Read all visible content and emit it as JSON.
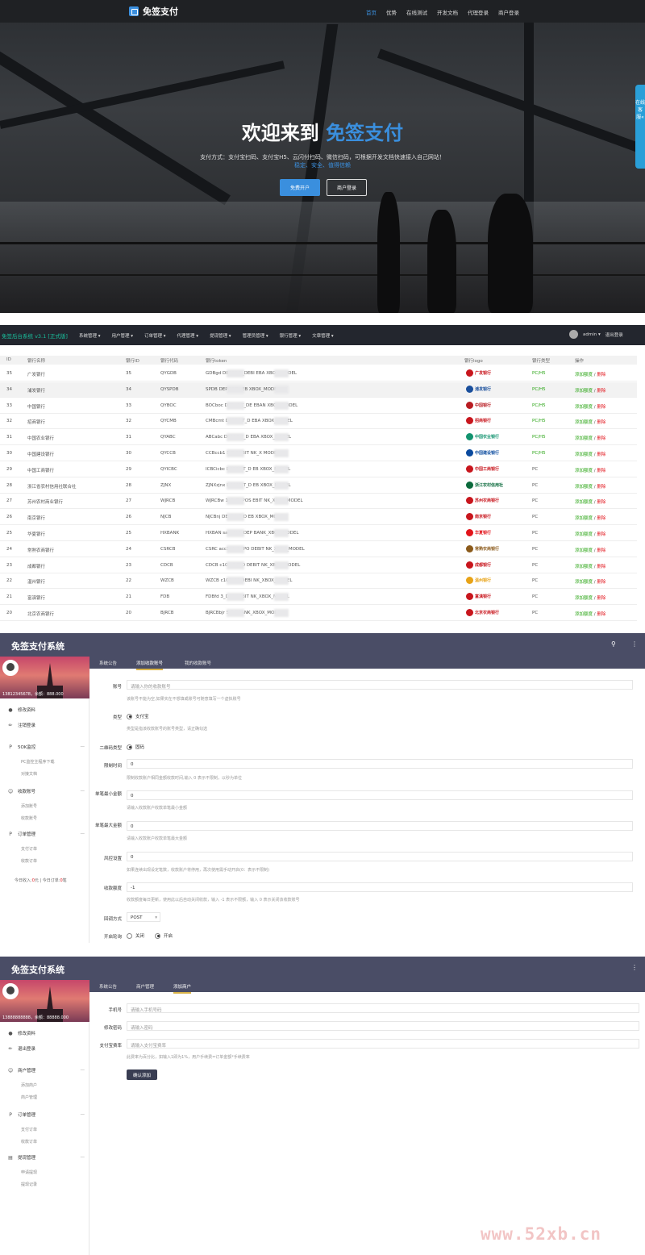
{
  "hero": {
    "brand": "免签支付",
    "nav": [
      "首页",
      "优势",
      "在线测试",
      "开发文档",
      "代理登录",
      "商户登录"
    ],
    "title_prefix": "欢迎来到",
    "title_highlight": "免签支付",
    "desc_line1": "支付方式：支付宝扫码、支付宝H5、云闪付扫码、微信扫码，可根据开发文档快速接入自己网站！",
    "desc_line2": "稳定、安全、值得信赖",
    "btn_register": "免费开户",
    "btn_login": "商户登录",
    "side_tab": "在线客服«",
    "accent": "#3a8fde"
  },
  "admin": {
    "brand": "免签后台系统 v3.1 [正式版]",
    "menu": [
      "系统管理 ▾",
      "用户管理 ▾",
      "订单管理 ▾",
      "代理管理 ▾",
      "提现管理 ▾",
      "管理员管理 ▾",
      "银行管理 ▾",
      "文章管理 ▾"
    ],
    "user": "admin ▾",
    "logout": "退出登录",
    "columns": [
      "ID",
      "银行名称",
      "银行ID",
      "银行代码",
      "银行token",
      "银行logo",
      "银行类型",
      "操作"
    ],
    "action_add": "添加额度",
    "action_sep": " / ",
    "action_del": "删除",
    "rows": [
      {
        "id": "35",
        "name": "广发银行",
        "bid": "35",
        "code": "QYGDB",
        "token": "GDBgd DEPOSIT_DEBI EBA XBOX_MODEL",
        "logo": "广发银行",
        "logo_color": "#c8161d",
        "type": "PC/H5"
      },
      {
        "id": "34",
        "name": "浦发银行",
        "bid": "34",
        "code": "QYSPDB",
        "token": "SPDB DEPOSIT_ EB XBOX_MODEL",
        "logo": "浦发银行",
        "logo_color": "#1a4f9c",
        "type": "PC/H5"
      },
      {
        "id": "33",
        "name": "中国银行",
        "bid": "33",
        "code": "QYBOC",
        "token": "BOCboc DEPOSIT_DE EBAN XBOX_MODEL",
        "logo": "中国银行",
        "logo_color": "#b81c22",
        "type": "PC/H5"
      },
      {
        "id": "32",
        "name": "招商银行",
        "bid": "32",
        "code": "QYCMB",
        "token": "CMBcmt DEPOSIT_D EBA XBOX_MODEL",
        "logo": "招商银行",
        "logo_color": "#c8161d",
        "type": "PC/H5"
      },
      {
        "id": "31",
        "name": "中国农业银行",
        "bid": "31",
        "code": "QYABC",
        "token": "ABCabc DEPOSIT_D EBA XBOX_MODEL",
        "logo": "中国农业银行",
        "logo_color": "#12936f",
        "type": "PC/H5"
      },
      {
        "id": "30",
        "name": "中国建设银行",
        "bid": "30",
        "code": "QYCCB",
        "token": "CCBccb1 SIT_DEBIT NK_X MODEL",
        "logo": "中国建设银行",
        "logo_color": "#0a4a9e",
        "type": "PC/H5"
      },
      {
        "id": "29",
        "name": "中国工商银行",
        "bid": "29",
        "code": "QYICBC",
        "token": "ICBCicbc DEPOSIT_D EB XBOX_MODEL",
        "logo": "中国工商银行",
        "logo_color": "#c8161d",
        "type": "PC"
      },
      {
        "id": "28",
        "name": "浙江省农村信用社联合社",
        "bid": "28",
        "code": "ZJNX",
        "token": "ZJNXzjnx DEPOSIT_D EB XBOX_MODEL",
        "logo": "浙江农村信用社",
        "logo_color": "#0b6a3c",
        "type": "PC"
      },
      {
        "id": "27",
        "name": "苏州农村商业银行",
        "bid": "27",
        "code": "WJRCB",
        "token": "WJRCBw 103_DEPOS EBIT NK_XBOX_MODEL",
        "logo": "苏州农商银行",
        "logo_color": "#c8161d",
        "type": "PC"
      },
      {
        "id": "26",
        "name": "南京银行",
        "bid": "26",
        "code": "NJCB",
        "token": "NJCBnj DEPOSIT_D EB XBOX_MODEL",
        "logo": "南京银行",
        "logo_color": "#c8161d",
        "type": "PC"
      },
      {
        "id": "25",
        "name": "华夏银行",
        "bid": "25",
        "code": "HXBANK",
        "token": "HXBAN sacc103_DEP BANK_XBOX_MODEL",
        "logo": "华夏银行",
        "logo_color": "#e2141b",
        "type": "PC"
      },
      {
        "id": "24",
        "name": "常熟农商银行",
        "bid": "24",
        "code": "CSRCB",
        "token": "CSRC acc103_DEPO DEBIT NK_XBOX_MODEL",
        "logo": "常熟农商银行",
        "logo_color": "#8b5a1b",
        "type": "PC"
      },
      {
        "id": "23",
        "name": "成都银行",
        "bid": "23",
        "code": "CDCB",
        "token": "CDCB c103_DEPO DEBIT NK_XBOX_MODEL",
        "logo": "成都银行",
        "logo_color": "#c8161d",
        "type": "PC"
      },
      {
        "id": "22",
        "name": "温州银行",
        "bid": "22",
        "code": "WZCB",
        "token": "WZCB c103_DE DEBI NK_XBOX_MODEL",
        "logo": "温州银行",
        "logo_color": "#e8a317",
        "type": "PC"
      },
      {
        "id": "21",
        "name": "富滇银行",
        "bid": "21",
        "code": "FDB",
        "token": "FDBfd 3_DEP DEBIT NK_XBOX_MODEL",
        "logo": "富滇银行",
        "logo_color": "#c8161d",
        "type": "PC"
      },
      {
        "id": "20",
        "name": "北京农商银行",
        "bid": "20",
        "code": "BJRCB",
        "token": "BJRCBbjr SIT_EBANK_XBOX_MODEL",
        "logo": "北京农商银行",
        "logo_color": "#c8161d",
        "type": "PC"
      }
    ]
  },
  "panel1": {
    "title": "免签支付系统",
    "user_info": "13812345678，余额：888.000",
    "side": [
      {
        "icon": "person",
        "label": "修改资料"
      },
      {
        "icon": "exit",
        "label": "注销登录"
      }
    ],
    "groups": [
      {
        "icon": "P",
        "label": "5OK监控",
        "subs": [
          "PC监控主程序下载",
          "对接文档"
        ]
      },
      {
        "icon": "people",
        "label": "收款账号",
        "subs": [
          "添加账号",
          "收款账号"
        ]
      },
      {
        "icon": "P",
        "label": "订单管理",
        "subs": [
          "支付订单",
          "收款订单"
        ]
      }
    ],
    "stats": "今日收入:0元 | 今日订单:0笔",
    "stats_prefix": "今日收入:",
    "stats_income": "0",
    "stats_mid": "元 | 今日订单:",
    "stats_orders": "0",
    "stats_suffix": "笔",
    "tabs": [
      "系统公告",
      "添加收款账号",
      "我的收款账号"
    ],
    "form": {
      "account_label": "账号",
      "account_placeholder": "请输入你的收款账号",
      "account_hint": "该账号不能为空,如果实在不想填或账号可随意填写一个虚拟账号",
      "type_label": "类型",
      "type_option": "支付宝",
      "type_hint": "类型是指该收款账号的账号类型，请正确勾选",
      "qr_label": "二维码类型",
      "qr_option": "固码",
      "limit_time_label": "限制时间",
      "limit_time_value": "0",
      "limit_time_hint": "限制收款账户相同金额收款时间,输入 0 表示不限制，以秒为单位",
      "min_label": "单笔最小金额",
      "min_value": "0",
      "min_hint": "请输入收款账户收款单笔最小金额",
      "max_label": "单笔最大金额",
      "max_value": "0",
      "max_hint": "请输入收款账户收款单笔最大金额",
      "risk_label": "风控设置",
      "risk_value": "0",
      "risk_hint": "如果连续出现设定笔数，收款账户将停用，再次使用需手动开启(0：表示不限制)",
      "quota_label": "收款额度",
      "quota_value": "-1",
      "quota_hint": "收款额度每日更新，使用此以后自动关闭收款，输入 -1 表示不限额，输入 0 表示关闭该收款账号",
      "callback_label": "回调方式",
      "callback_value": "POST",
      "toggle_label": "开启轮询",
      "toggle_off": "关闭",
      "toggle_on": "开启"
    }
  },
  "panel2": {
    "title": "免签支付系统",
    "user_info": "13888888888，余额：88888.000",
    "side": [
      {
        "icon": "person",
        "label": "修改资料"
      },
      {
        "icon": "exit",
        "label": "退出登录"
      }
    ],
    "groups": [
      {
        "icon": "people",
        "label": "商户管理",
        "subs": [
          "添加商户",
          "商户管理"
        ]
      },
      {
        "icon": "P",
        "label": "订单管理",
        "subs": [
          "支付订单",
          "收款订单"
        ]
      },
      {
        "icon": "card",
        "label": "提现管理",
        "subs": [
          "申请提现",
          "提现记录"
        ]
      }
    ],
    "tabs": [
      "系统公告",
      "商户管理",
      "添加商户"
    ],
    "form": {
      "phone_label": "手机号",
      "phone_placeholder": "请输入手机号码",
      "pwd_label": "修改密码",
      "pwd_placeholder": "请输入密码",
      "rate_label": "支付宝费率",
      "rate_placeholder": "请输入支付宝费率",
      "rate_hint": "此费率为百分比，如输入1即为1%，用户手续费=订单金额*手续费率",
      "submit": "确认添加"
    }
  },
  "watermark": "www.52xb.cn"
}
